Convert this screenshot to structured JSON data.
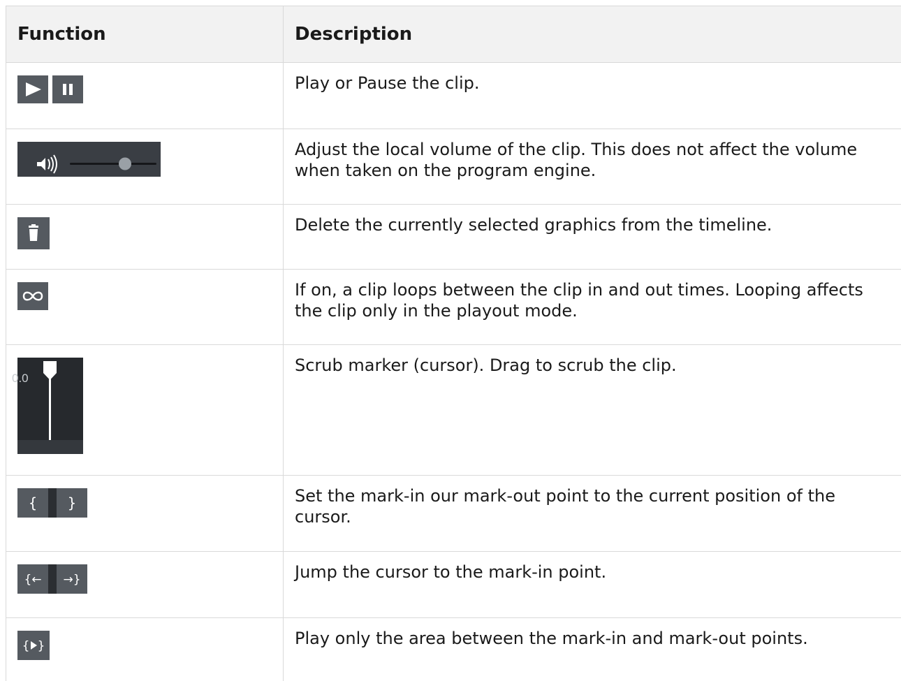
{
  "table": {
    "headers": {
      "function": "Function",
      "description": "Description"
    },
    "rows": [
      {
        "icons": [
          "play-icon",
          "pause-icon"
        ],
        "description": "Play or Pause the clip."
      },
      {
        "icons": [
          "volume-slider-icon"
        ],
        "description": "Adjust the local volume of the clip. This does not affect the volume when taken on the program engine."
      },
      {
        "icons": [
          "trash-icon"
        ],
        "description": "Delete the currently selected graphics from the timeline."
      },
      {
        "icons": [
          "loop-icon"
        ],
        "description": "If on, a clip loops between the clip in and out times. Looping affects the clip only in the playout mode."
      },
      {
        "icons": [
          "scrub-marker-icon"
        ],
        "time_label": "0.0",
        "description": "Scrub marker (cursor). Drag to scrub the clip."
      },
      {
        "icons": [
          "mark-in-icon",
          "mark-out-icon"
        ],
        "description": "Set the mark-in our mark-out point to the current position of the cursor."
      },
      {
        "icons": [
          "jump-to-mark-in-icon",
          "jump-to-mark-out-icon"
        ],
        "description": "Jump the cursor to the mark-in point."
      },
      {
        "icons": [
          "play-between-marks-icon"
        ],
        "description": "Play only the area between the mark-in and mark-out points."
      }
    ]
  },
  "colors": {
    "icon_background": "#555a60",
    "scrub_background": "#26292d",
    "header_background": "#f2f2f2",
    "border": "#d9d9d9"
  }
}
